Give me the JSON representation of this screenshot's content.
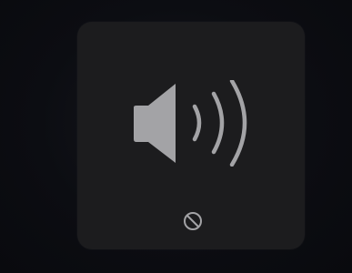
{
  "hud": {
    "type": "volume",
    "volume_level": 1.0,
    "muted": false
  },
  "icons": {
    "main": "speaker-volume-high-icon",
    "indicator": "no-entry-icon"
  },
  "colors": {
    "background": "#0c0d12",
    "panel": "#1c1c1e",
    "icon": "#a3a3a6"
  }
}
